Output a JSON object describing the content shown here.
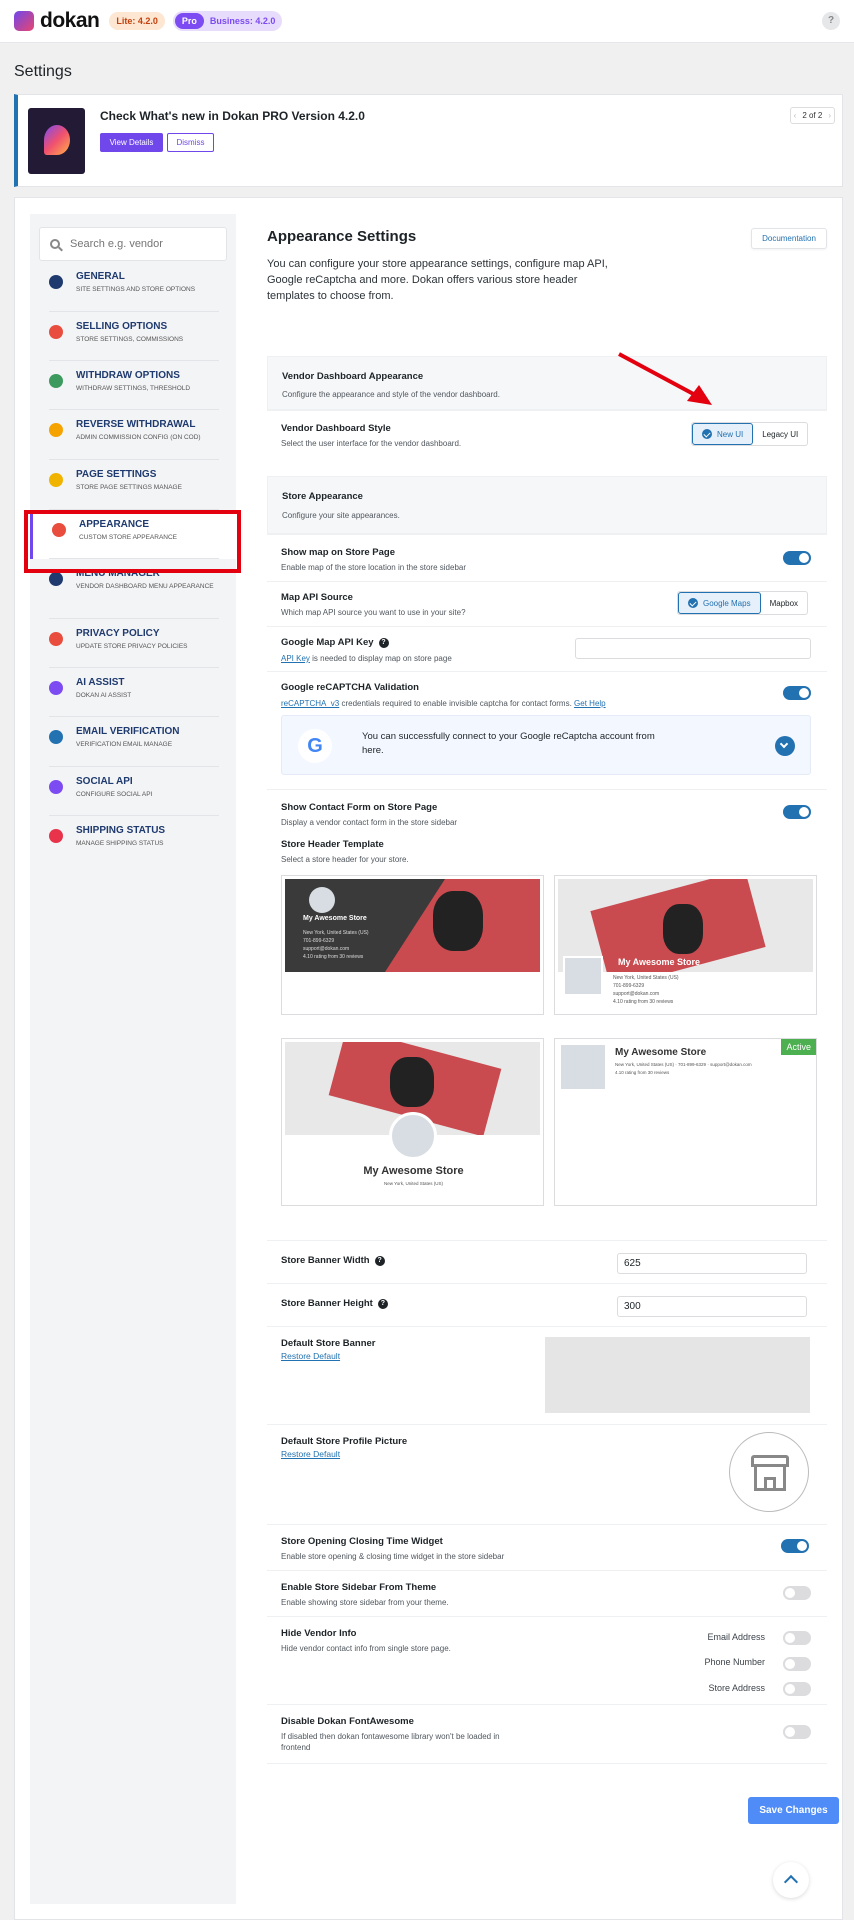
{
  "app": {
    "logo_text": "dokan",
    "lite_badge": "Lite: 4.2.0",
    "pro_badge": "Pro",
    "business_badge": "Business: 4.2.0",
    "help_glyph": "?"
  },
  "page": {
    "title": "Settings"
  },
  "notice": {
    "title": "Check What's new in Dokan PRO Version 4.2.0",
    "view_label": "View Details",
    "dismiss_label": "Dismiss",
    "pager": "2 of 2",
    "prev": "‹",
    "next": "›"
  },
  "sidebar": {
    "search_placeholder": "Search e.g. vendor",
    "items": [
      {
        "title": "GENERAL",
        "sub": "SITE SETTINGS AND STORE OPTIONS",
        "color": "#1f3a6e"
      },
      {
        "title": "SELLING OPTIONS",
        "sub": "STORE SETTINGS, COMMISSIONS",
        "color": "#e84d3d"
      },
      {
        "title": "WITHDRAW OPTIONS",
        "sub": "WITHDRAW SETTINGS, THRESHOLD",
        "color": "#3c9a5f"
      },
      {
        "title": "REVERSE WITHDRAWAL",
        "sub": "ADMIN COMMISSION CONFIG (ON COD)",
        "color": "#f4a300"
      },
      {
        "title": "PAGE SETTINGS",
        "sub": "STORE PAGE SETTINGS MANAGE",
        "color": "#f0b400"
      },
      {
        "title": "APPEARANCE",
        "sub": "CUSTOM STORE APPEARANCE",
        "color": "#e84d3d"
      },
      {
        "title": "MENU MANAGER",
        "sub": "VENDOR DASHBOARD MENU APPEARANCE",
        "color": "#1f3a6e"
      },
      {
        "title": "PRIVACY POLICY",
        "sub": "UPDATE STORE PRIVACY POLICIES",
        "color": "#e84d3d"
      },
      {
        "title": "AI ASSIST",
        "sub": "DOKAN AI ASSIST",
        "color": "#7c4bf2"
      },
      {
        "title": "EMAIL VERIFICATION",
        "sub": "VERIFICATION EMAIL MANAGE",
        "color": "#2271b1"
      },
      {
        "title": "SOCIAL API",
        "sub": "CONFIGURE SOCIAL API",
        "color": "#7c4bf2"
      },
      {
        "title": "SHIPPING STATUS",
        "sub": "MANAGE SHIPPING STATUS",
        "color": "#e8334a"
      }
    ]
  },
  "content": {
    "title": "Appearance Settings",
    "doc_label": "Documentation",
    "description": "You can configure your store appearance settings, configure map API, Google reCaptcha and more. Dokan offers various store header templates to choose from.",
    "vendor_dash": {
      "title": "Vendor Dashboard Appearance",
      "desc": "Configure the appearance and style of the vendor dashboard.",
      "style_title": "Vendor Dashboard Style",
      "style_desc": "Select the user interface for the vendor dashboard.",
      "new_ui": "New UI",
      "legacy_ui": "Legacy UI"
    },
    "store_appearance": {
      "title": "Store Appearance",
      "desc": "Configure your site appearances."
    },
    "show_map": {
      "title": "Show map on Store Page",
      "desc": "Enable map of the store location in the store sidebar"
    },
    "map_api": {
      "title": "Map API Source",
      "desc": "Which map API source you want to use in your site?",
      "google": "Google Maps",
      "mapbox": "Mapbox"
    },
    "gmap_key": {
      "title": "Google Map API Key",
      "link": "API Key",
      "desc": " is needed to display map on store page",
      "value": ""
    },
    "recaptcha": {
      "title": "Google reCAPTCHA Validation",
      "link": "reCAPTCHA_v3",
      "desc": " credentials required to enable invisible captcha for contact forms. ",
      "help_link": "Get Help",
      "info": "You can successfully connect to your Google reCaptcha account from here."
    },
    "contact_form": {
      "title": "Show Contact Form on Store Page",
      "desc": "Display a vendor contact form in the store sidebar"
    },
    "header_tpl": {
      "title": "Store Header Template",
      "desc": "Select a store header for your store.",
      "store_name": "My Awesome Store",
      "address": "New York, United States (US)",
      "phone": "701-899-6329",
      "email": "support@dokan.com",
      "rating": "4.10 rating from 30 reviews",
      "active": "Active"
    },
    "banner_width": {
      "title": "Store Banner Width",
      "value": "625"
    },
    "banner_height": {
      "title": "Store Banner Height",
      "value": "300"
    },
    "default_banner": {
      "title": "Default Store Banner",
      "link": "Restore Default"
    },
    "default_profile": {
      "title": "Default Store Profile Picture",
      "link": "Restore Default"
    },
    "opening_widget": {
      "title": "Store Opening Closing Time Widget",
      "desc": "Enable store opening & closing time widget in the store sidebar"
    },
    "sidebar_theme": {
      "title": "Enable Store Sidebar From Theme",
      "desc": "Enable showing store sidebar from your theme."
    },
    "hide_vendor": {
      "title": "Hide Vendor Info",
      "desc": "Hide vendor contact info from single store page.",
      "email": "Email Address",
      "phone": "Phone Number",
      "address": "Store Address"
    },
    "fontawesome": {
      "title": "Disable Dokan FontAwesome",
      "desc": "If disabled then dokan fontawesome library won't be loaded in frontend"
    },
    "save_label": "Save Changes"
  }
}
